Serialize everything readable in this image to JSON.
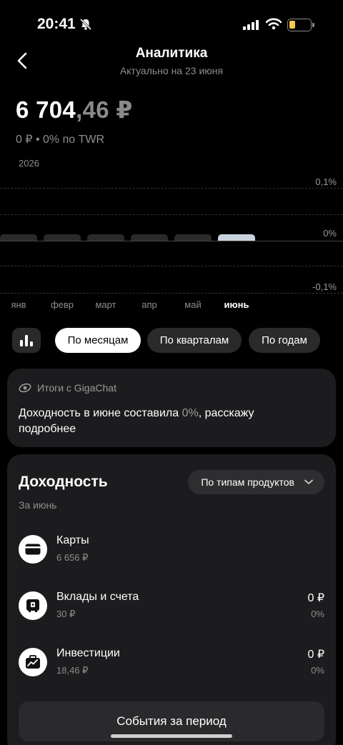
{
  "status": {
    "time": "20:41"
  },
  "header": {
    "title": "Аналитика",
    "subtitle": "Актуально на 23 июня"
  },
  "balance": {
    "whole": "6 704",
    "decimal": ",46 ₽",
    "change": "0 ₽ • 0%  по TWR"
  },
  "chart_data": {
    "type": "bar",
    "year_label": "2026",
    "categories": [
      "янв",
      "февр",
      "март",
      "апр",
      "май",
      "июнь"
    ],
    "values": [
      0,
      0,
      0,
      0,
      0,
      0
    ],
    "active_category": "июнь",
    "y_ticks": [
      "0,1%",
      "0%",
      "-0,1%"
    ],
    "ylim": [
      -0.1,
      0.1
    ],
    "colors": {
      "bar": "#2a2a2a",
      "active_bar": "#c8d3de"
    }
  },
  "period_selector": {
    "icon": "bar-chart-icon",
    "options": [
      "По месяцам",
      "По кварталам",
      "По годам"
    ],
    "selected": "По месяцам"
  },
  "gigachat": {
    "header": "Итоги с GigaChat",
    "text_before": "Доходность в июне составила ",
    "text_pct": "0%",
    "text_after": ", расскажу подробнее"
  },
  "yield": {
    "title": "Доходность",
    "period": "За июнь",
    "dropdown": "По типам продуктов",
    "items": [
      {
        "name": "Карты",
        "value": "6 656 ₽",
        "return": "",
        "percent": "",
        "icon": "card-icon"
      },
      {
        "name": "Вклады и счета",
        "value": "30 ₽",
        "return": "0 ₽",
        "percent": "0%",
        "icon": "safe-icon"
      },
      {
        "name": "Инвестиции",
        "value": "18,46 ₽",
        "return": "0 ₽",
        "percent": "0%",
        "icon": "briefcase-chart-icon"
      }
    ]
  },
  "events_button": "События за период"
}
